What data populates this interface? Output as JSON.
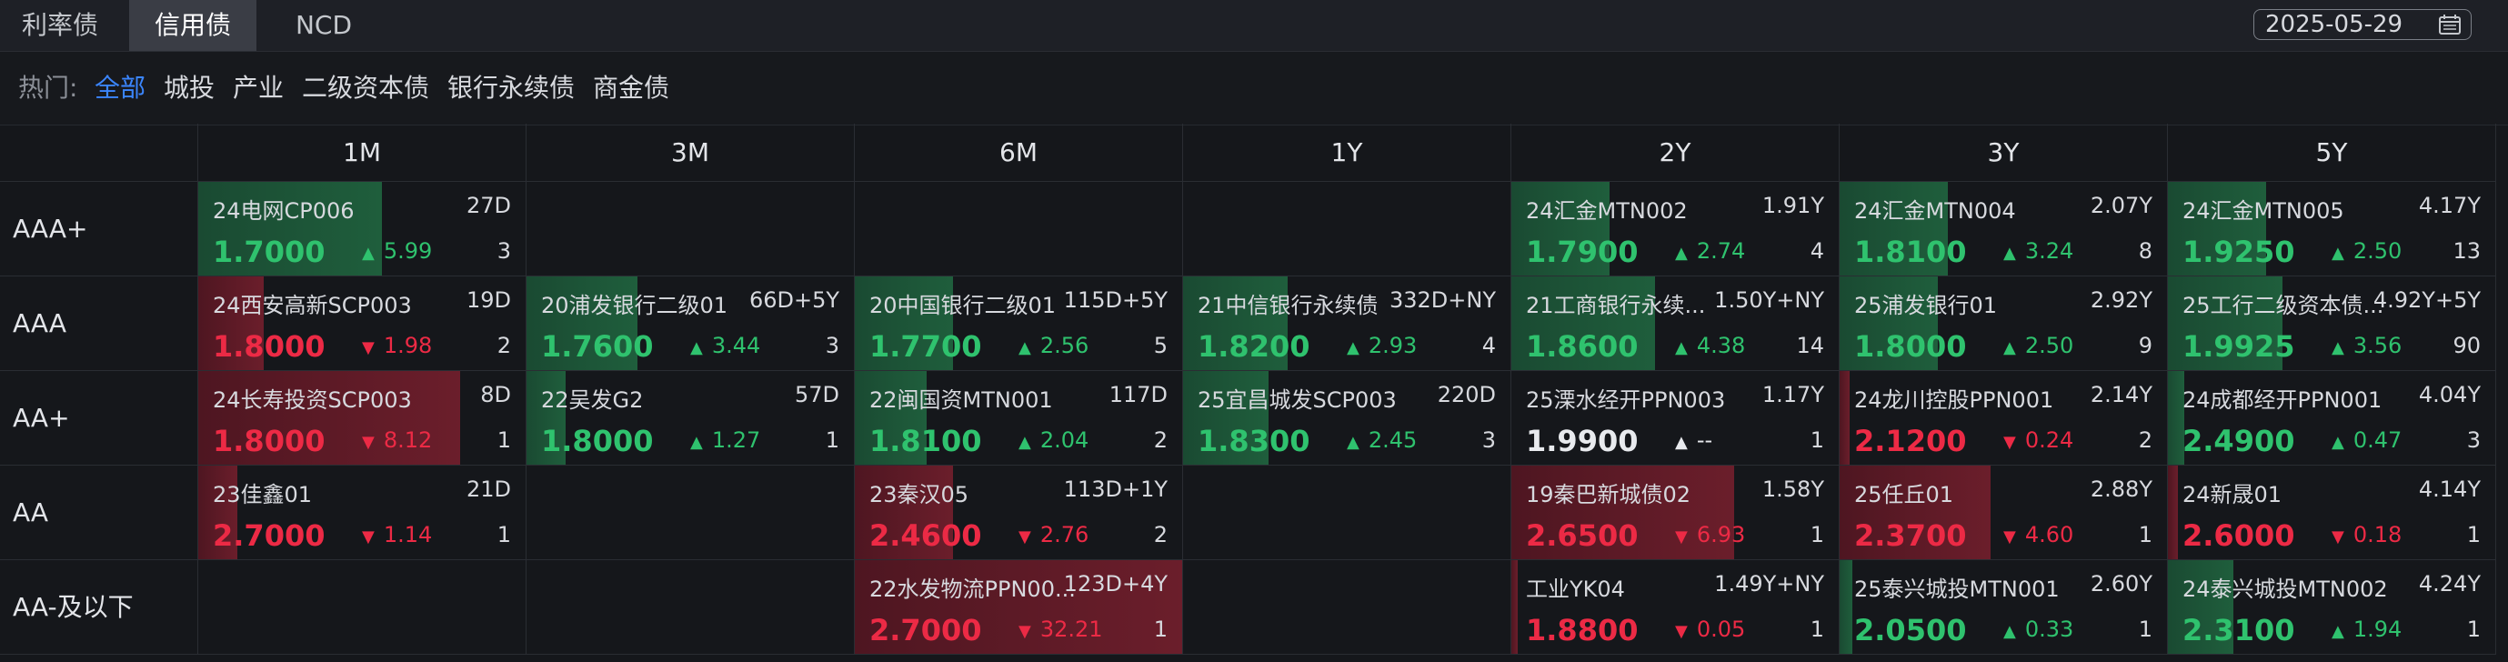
{
  "top_tabs": [
    {
      "label": "利率债",
      "active": false
    },
    {
      "label": "信用债",
      "active": true
    },
    {
      "label": "NCD",
      "active": false
    }
  ],
  "date": "2025-05-29",
  "filters": {
    "label": "热门:",
    "items": [
      {
        "label": "全部",
        "active": true
      },
      {
        "label": "城投",
        "active": false
      },
      {
        "label": "产业",
        "active": false
      },
      {
        "label": "二级资本债",
        "active": false
      },
      {
        "label": "银行永续债",
        "active": false
      },
      {
        "label": "商金债",
        "active": false
      }
    ]
  },
  "columns": [
    "1M",
    "3M",
    "6M",
    "1Y",
    "2Y",
    "3Y",
    "5Y"
  ],
  "rows": [
    "AAA+",
    "AAA",
    "AA+",
    "AA",
    "AA-及以下"
  ],
  "colors": {
    "up": "#2fc26e",
    "down": "#ec2a45",
    "up_bg": "#1f5e3c",
    "down_bg": "#6b1e2b"
  },
  "cells": [
    {
      "row": 0,
      "col": 0,
      "name": "24电网CP006",
      "term": "27D",
      "yield": "1.7000",
      "dir": "up",
      "change": "5.99",
      "count": "3",
      "level": 0.56
    },
    {
      "row": 0,
      "col": 4,
      "name": "24汇金MTN002",
      "term": "1.91Y",
      "yield": "1.7900",
      "dir": "up",
      "change": "2.74",
      "count": "4",
      "level": 0.3
    },
    {
      "row": 0,
      "col": 5,
      "name": "24汇金MTN004",
      "term": "2.07Y",
      "yield": "1.8100",
      "dir": "up",
      "change": "3.24",
      "count": "8",
      "level": 0.33
    },
    {
      "row": 0,
      "col": 6,
      "name": "24汇金MTN005",
      "term": "4.17Y",
      "yield": "1.9250",
      "dir": "up",
      "change": "2.50",
      "count": "13",
      "level": 0.3
    },
    {
      "row": 1,
      "col": 0,
      "name": "24西安高新SCP003",
      "term": "19D",
      "yield": "1.8000",
      "dir": "down",
      "change": "1.98",
      "count": "2",
      "level": 0.2
    },
    {
      "row": 1,
      "col": 1,
      "name": "20浦发银行二级01",
      "term": "66D+5Y",
      "yield": "1.7600",
      "dir": "up",
      "change": "3.44",
      "count": "3",
      "level": 0.34
    },
    {
      "row": 1,
      "col": 2,
      "name": "20中国银行二级01",
      "term": "115D+5Y",
      "yield": "1.7700",
      "dir": "up",
      "change": "2.56",
      "count": "5",
      "level": 0.3
    },
    {
      "row": 1,
      "col": 3,
      "name": "21中信银行永续债",
      "term": "332D+NY",
      "yield": "1.8200",
      "dir": "up",
      "change": "2.93",
      "count": "4",
      "level": 0.32
    },
    {
      "row": 1,
      "col": 4,
      "name": "21工商银行永续...",
      "term": "1.50Y+NY",
      "yield": "1.8600",
      "dir": "up",
      "change": "4.38",
      "count": "14",
      "level": 0.44
    },
    {
      "row": 1,
      "col": 5,
      "name": "25浦发银行01",
      "term": "2.92Y",
      "yield": "1.8000",
      "dir": "up",
      "change": "2.50",
      "count": "9",
      "level": 0.3
    },
    {
      "row": 1,
      "col": 6,
      "name": "25工行二级资本债...",
      "term": "4.92Y+5Y",
      "yield": "1.9925",
      "dir": "up",
      "change": "3.56",
      "count": "90",
      "level": 0.35
    },
    {
      "row": 2,
      "col": 0,
      "name": "24长寿投资SCP003",
      "term": "8D",
      "yield": "1.8000",
      "dir": "down",
      "change": "8.12",
      "count": "1",
      "level": 0.8
    },
    {
      "row": 2,
      "col": 1,
      "name": "22吴发G2",
      "term": "57D",
      "yield": "1.8000",
      "dir": "up",
      "change": "1.27",
      "count": "1",
      "level": 0.12
    },
    {
      "row": 2,
      "col": 2,
      "name": "22闽国资MTN001",
      "term": "117D",
      "yield": "1.8100",
      "dir": "up",
      "change": "2.04",
      "count": "2",
      "level": 0.22
    },
    {
      "row": 2,
      "col": 3,
      "name": "25宜昌城发SCP003",
      "term": "220D",
      "yield": "1.8300",
      "dir": "up",
      "change": "2.45",
      "count": "3",
      "level": 0.26
    },
    {
      "row": 2,
      "col": 4,
      "name": "25溧水经开PPN003",
      "term": "1.17Y",
      "yield": "1.9900",
      "dir": "flat",
      "change": "--",
      "count": "1",
      "level": 0
    },
    {
      "row": 2,
      "col": 5,
      "name": "24龙川控股PPN001",
      "term": "2.14Y",
      "yield": "2.1200",
      "dir": "down",
      "change": "0.24",
      "count": "2",
      "level": 0.03
    },
    {
      "row": 2,
      "col": 6,
      "name": "24成都经开PPN001",
      "term": "4.04Y",
      "yield": "2.4900",
      "dir": "up",
      "change": "0.47",
      "count": "3",
      "level": 0.05
    },
    {
      "row": 3,
      "col": 0,
      "name": "23佳鑫01",
      "term": "21D",
      "yield": "2.7000",
      "dir": "down",
      "change": "1.14",
      "count": "1",
      "level": 0.12
    },
    {
      "row": 3,
      "col": 2,
      "name": "23秦汉05",
      "term": "113D+1Y",
      "yield": "2.4600",
      "dir": "down",
      "change": "2.76",
      "count": "2",
      "level": 0.3
    },
    {
      "row": 3,
      "col": 4,
      "name": "19秦巴新城债02",
      "term": "1.58Y",
      "yield": "2.6500",
      "dir": "down",
      "change": "6.93",
      "count": "1",
      "level": 0.68
    },
    {
      "row": 3,
      "col": 5,
      "name": "25任丘01",
      "term": "2.88Y",
      "yield": "2.3700",
      "dir": "down",
      "change": "4.60",
      "count": "1",
      "level": 0.46
    },
    {
      "row": 3,
      "col": 6,
      "name": "24新晟01",
      "term": "4.14Y",
      "yield": "2.6000",
      "dir": "down",
      "change": "0.18",
      "count": "1",
      "level": 0.03
    },
    {
      "row": 4,
      "col": 2,
      "name": "22水发物流PPN00...",
      "term": "123D+4Y",
      "yield": "2.7000",
      "dir": "down",
      "change": "32.21",
      "count": "1",
      "level": 1.0
    },
    {
      "row": 4,
      "col": 4,
      "name": "工业YK04",
      "term": "1.49Y+NY",
      "yield": "1.8800",
      "dir": "down",
      "change": "0.05",
      "count": "1",
      "level": 0.01
    },
    {
      "row": 4,
      "col": 5,
      "name": "25泰兴城投MTN001",
      "term": "2.60Y",
      "yield": "2.0500",
      "dir": "up",
      "change": "0.33",
      "count": "1",
      "level": 0.04
    },
    {
      "row": 4,
      "col": 6,
      "name": "24泰兴城投MTN002",
      "term": "4.24Y",
      "yield": "2.3100",
      "dir": "up",
      "change": "1.94",
      "count": "1",
      "level": 0.2
    }
  ]
}
